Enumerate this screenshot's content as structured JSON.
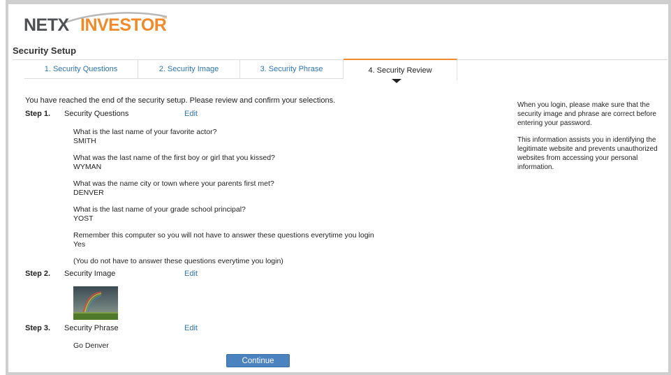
{
  "brand": {
    "part1": "NETX",
    "part2": "INVESTOR",
    "tm": "™"
  },
  "page": {
    "title": "Security Setup"
  },
  "tabs": [
    {
      "label": "1. Security Questions"
    },
    {
      "label": "2. Security Image"
    },
    {
      "label": "3. Security Phrase"
    },
    {
      "label": "4. Security Review"
    }
  ],
  "main": {
    "intro": "You have reached the end of the security setup. Please review and confirm your selections.",
    "edit_label": "Edit",
    "step1": {
      "num": "Step 1.",
      "label": "Security Questions",
      "items": [
        {
          "q": "What is the last name of your favorite actor?",
          "a": "SMITH"
        },
        {
          "q": "What was the last name of the first boy or girl that you kissed?",
          "a": "WYMAN"
        },
        {
          "q": "What was the name city or town where your parents first met?",
          "a": "DENVER"
        },
        {
          "q": "What is the last name of your grade school principal?",
          "a": "YOST"
        },
        {
          "q": "Remember this computer so you will not have to answer these questions everytime you login",
          "a": "Yes"
        }
      ],
      "note": "(You do not have to answer these questions everytime you login)"
    },
    "step2": {
      "num": "Step 2.",
      "label": "Security Image",
      "image_icon": "rainbow-landscape"
    },
    "step3": {
      "num": "Step 3.",
      "label": "Security Phrase",
      "phrase": "Go Denver"
    },
    "continue_label": "Continue"
  },
  "sidebar": {
    "para1": "When you login, please make sure that the security image and phrase are correct before entering your password.",
    "para2": "This information assists you in identifying the legitimate website and prevents unauthorized websites from accessing your personal information."
  },
  "colors": {
    "accent": "#f08a2a",
    "link": "#2c74b3",
    "button": "#4b82c0",
    "logo_gray": "#4d4f53"
  }
}
